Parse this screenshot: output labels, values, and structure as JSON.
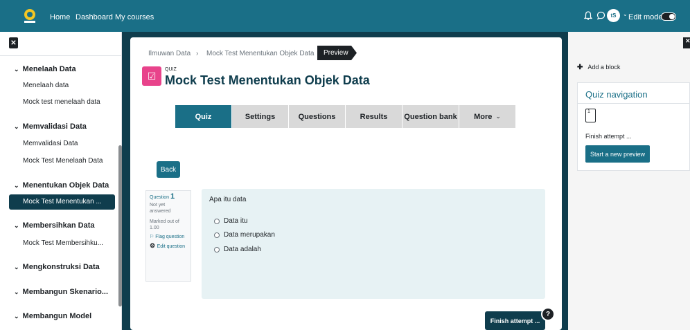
{
  "header": {
    "nav": [
      "Home",
      "Dashboard",
      "My courses"
    ],
    "user_initials": "tS",
    "edit_mode_label": "Edit mode"
  },
  "sidebar": {
    "sections": [
      {
        "title": "Menelaah Data",
        "items": [
          "Menelaah data",
          "Mock test menelaah data"
        ]
      },
      {
        "title": "Memvalidasi Data",
        "items": [
          "Memvalidasi Data",
          "Mock Test Menelaah Data"
        ]
      },
      {
        "title": "Menentukan Objek Data",
        "items": [
          "Mock Test Menentukan ..."
        ]
      },
      {
        "title": "Membersihkan Data",
        "items": [
          "Mock Test Membersihku..."
        ]
      },
      {
        "title": "Mengkonstruksi Data",
        "items": []
      },
      {
        "title": "Membangun Skenario...",
        "items": []
      },
      {
        "title": "Membangun Model",
        "items": []
      }
    ],
    "active_item": "Mock Test Menentukan ..."
  },
  "breadcrumb": [
    "Ilmuwan Data",
    "Mock Test Menentukan Objek Data",
    "Preview"
  ],
  "page": {
    "activity_type": "QUIZ",
    "title": "Mock Test Menentukan Objek Data"
  },
  "tabs": [
    "Quiz",
    "Settings",
    "Questions",
    "Results",
    "Question bank",
    "More"
  ],
  "active_tab": "Quiz",
  "back_label": "Back",
  "question_info": {
    "label": "Question",
    "number": "1",
    "status": "Not yet answered",
    "marks": "Marked out of 1.00",
    "flag": "Flag question",
    "edit": "Edit question"
  },
  "question": {
    "text": "Apa itu data",
    "options": [
      "Data itu",
      "Data merupakan",
      "Data adalah"
    ]
  },
  "finish_button": "Finish attempt ...",
  "help_button": "?",
  "right_drawer": {
    "add_block": "Add a block",
    "title": "Quiz navigation",
    "nav_number": "1",
    "finish_link": "Finish attempt ...",
    "start_preview": "Start a new preview"
  },
  "colors": {
    "brand": "#1a6f87",
    "dark": "#0f3d4d",
    "quiz_icon": "#e8438b"
  }
}
